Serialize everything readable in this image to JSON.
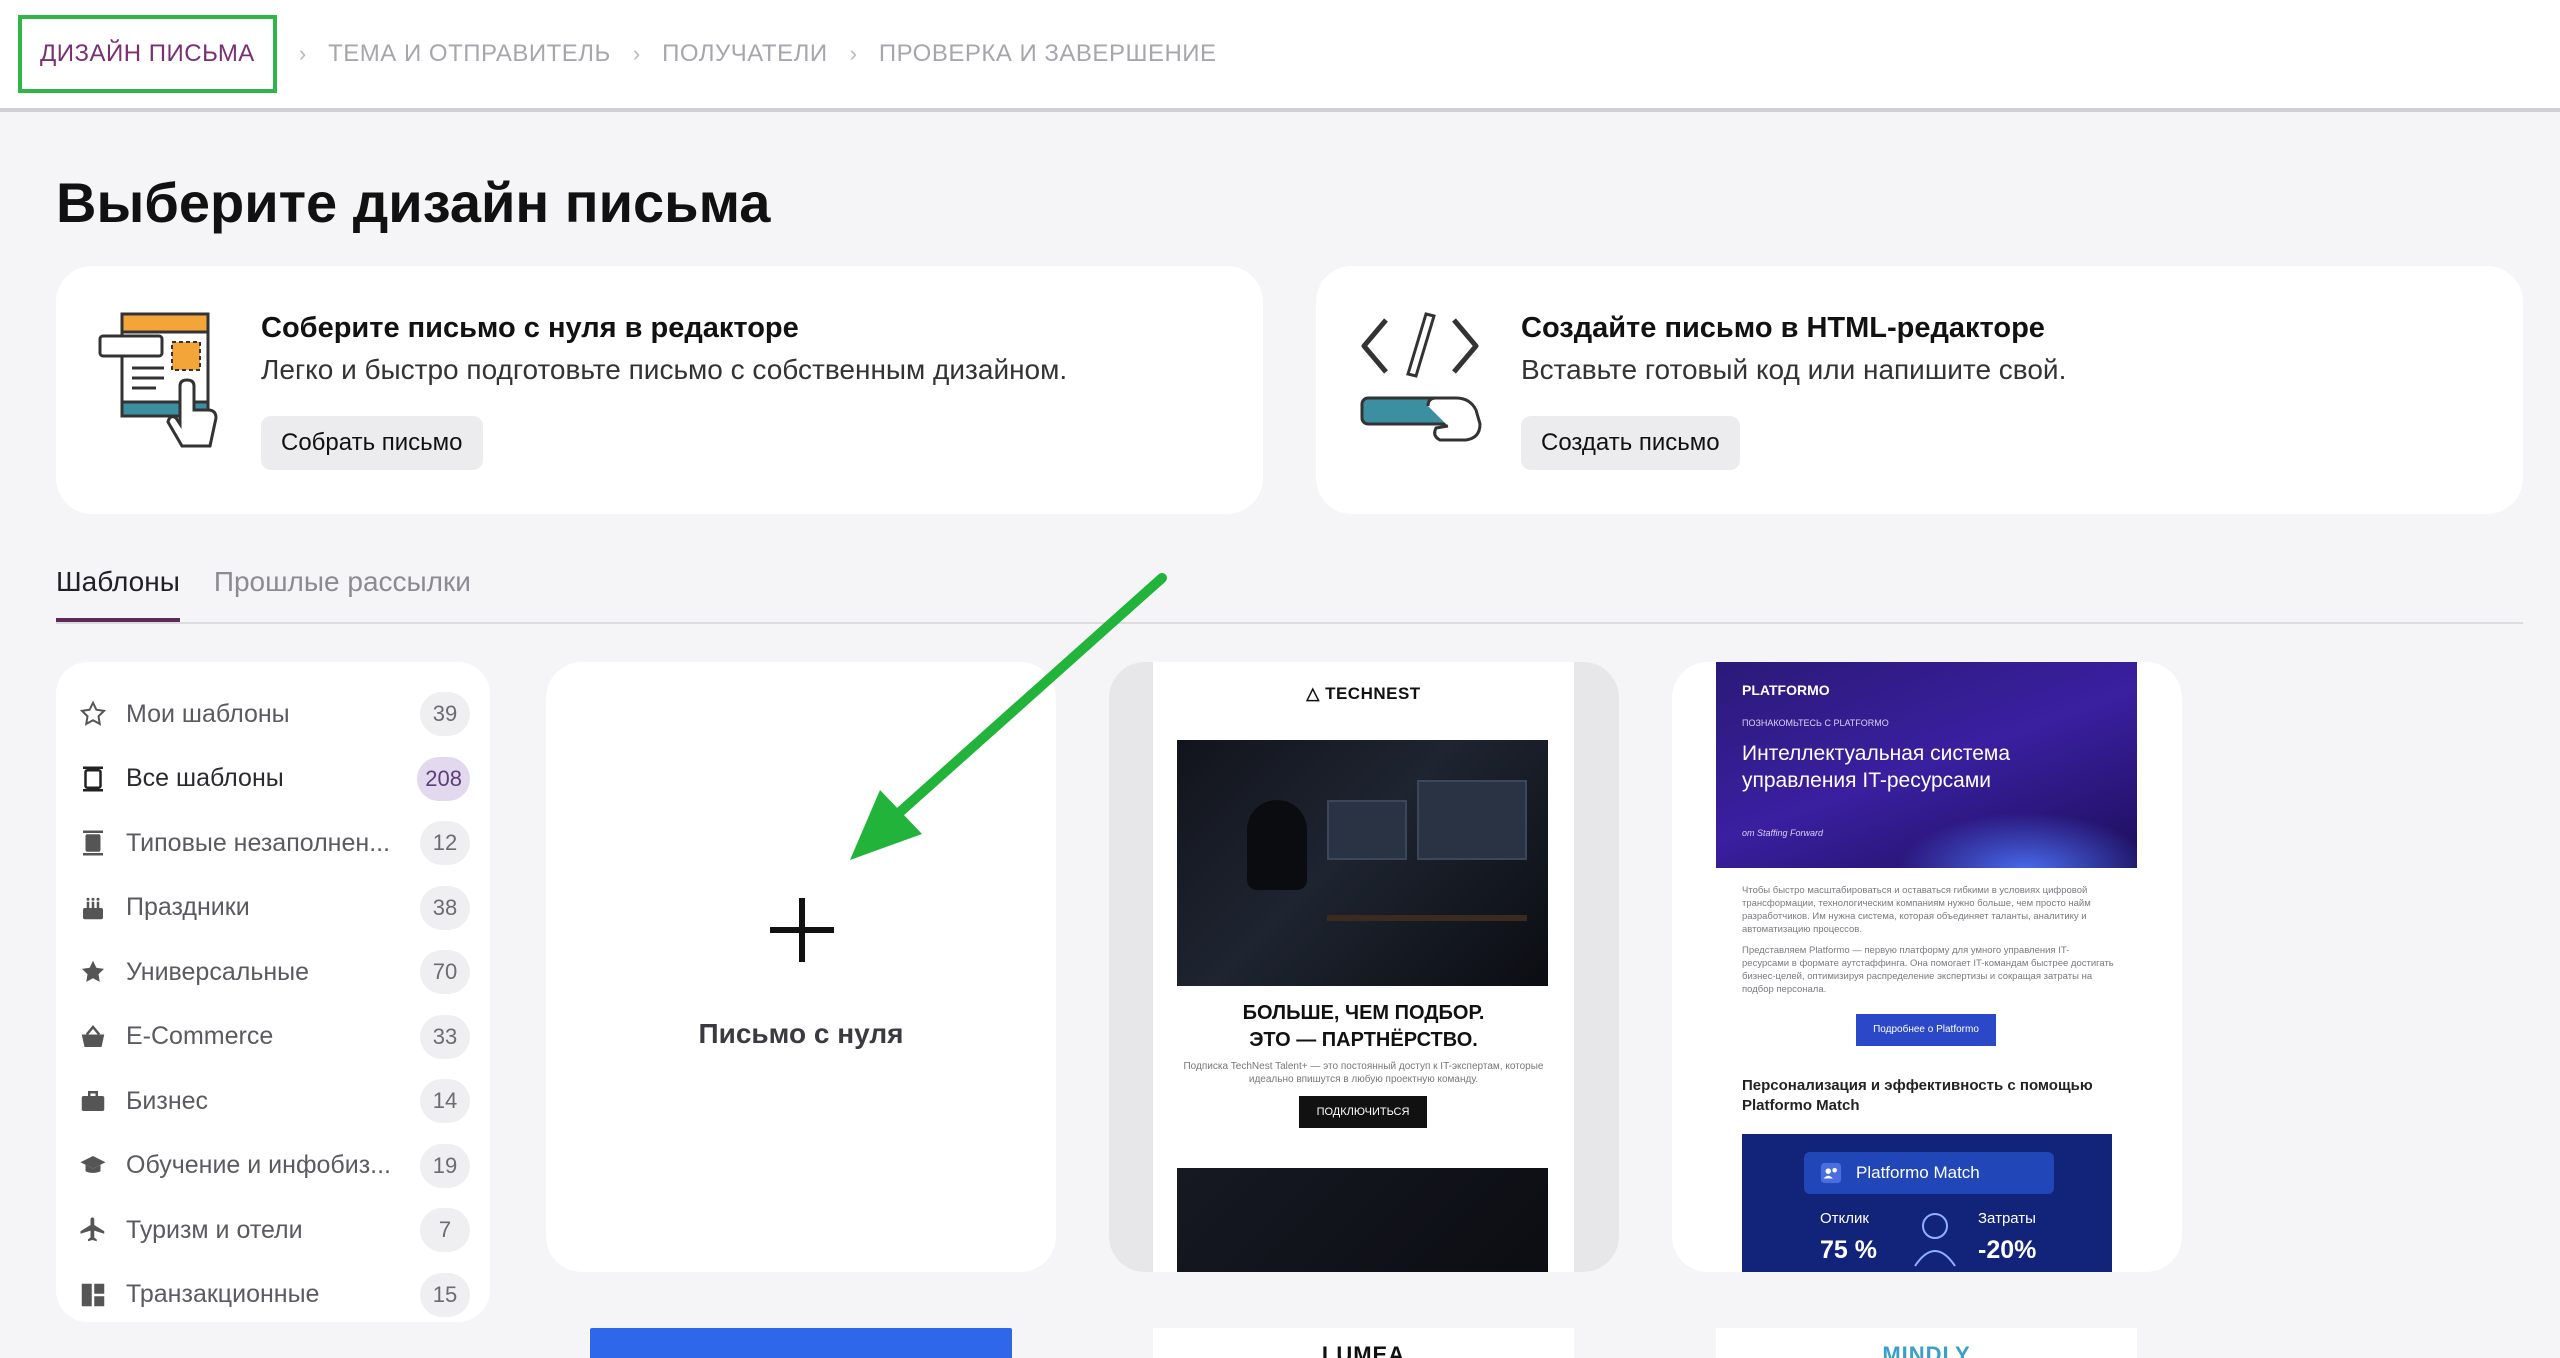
{
  "stepper": {
    "steps": [
      "ДИЗАЙН ПИСЬМА",
      "ТЕМА И ОТПРАВИТЕЛЬ",
      "ПОЛУЧАТЕЛИ",
      "ПРОВЕРКА И ЗАВЕРШЕНИЕ"
    ],
    "separator": "›"
  },
  "page_title": "Выберите дизайн письма",
  "features": {
    "builder": {
      "title": "Соберите письмо с нуля в редакторе",
      "description": "Легко и быстро подготовьте письмо с собственным дизайном.",
      "button": "Собрать письмо",
      "icon": "document-editor-icon"
    },
    "html": {
      "title": "Создайте письмо в HTML-редакторе",
      "description": "Вставьте готовый код или напишите свой.",
      "button": "Создать письмо",
      "icon": "code-tags-icon"
    }
  },
  "tabs": [
    "Шаблоны",
    "Прошлые рассылки"
  ],
  "categories": [
    {
      "label": "Мои шаблоны",
      "count": "39",
      "icon": "star-outline-icon"
    },
    {
      "label": "Все шаблоны",
      "count": "208",
      "icon": "template-stack-icon"
    },
    {
      "label": "Типовые незаполнен...",
      "count": "12",
      "icon": "template-blank-icon"
    },
    {
      "label": "Праздники",
      "count": "38",
      "icon": "cake-icon"
    },
    {
      "label": "Универсальные",
      "count": "70",
      "icon": "star-filled-icon"
    },
    {
      "label": "E-Commerce",
      "count": "33",
      "icon": "basket-icon"
    },
    {
      "label": "Бизнес",
      "count": "14",
      "icon": "briefcase-icon"
    },
    {
      "label": "Обучение и инфобиз...",
      "count": "19",
      "icon": "graduation-cap-icon"
    },
    {
      "label": "Туризм и отели",
      "count": "7",
      "icon": "airplane-icon"
    },
    {
      "label": "Транзакционные",
      "count": "15",
      "icon": "layout-icon"
    }
  ],
  "blank_template": {
    "label": "Письмо с нуля"
  },
  "technest": {
    "logo": "TECHNEST",
    "headline_1": "БОЛЬШЕ, ЧЕМ ПОДБОР.",
    "headline_2": "ЭТО — ПАРТНЁРСТВО.",
    "body": "Подписка TechNest Talent+ — это постоянный доступ к IT-экспертам, которые идеально впишутся в любую проектную команду.",
    "button": "ПОДКЛЮЧИТЬСЯ"
  },
  "platformo": {
    "logo": "PLATFORMO",
    "kicker": "ПОЗНАКОМЬТЕСЬ С PLATFORMO",
    "title": "Интеллектуальная система управления IT-ресурсами",
    "by": "от Staffing Forward",
    "text_1": "Чтобы быстро масштабироваться и оставаться гибкими в условиях цифровой трансформации, технологическим компаниям нужно больше, чем просто найм разработчиков. Им нужна система, которая объединяет таланты, аналитику и автоматизацию процессов.",
    "text_2": "Представляем Platformo — первую платформу для умного управления IT-ресурсами в формате аутстаффинга. Она помогает IT-командам быстрее достигать бизнес-целей, оптимизируя распределение экспертизы и сокращая затраты на подбор персонала.",
    "button": "Подробнее о Platformo",
    "subtitle": "Персонализация и эффективность с помощью Platformo Match",
    "panel_title": "Platformo Match",
    "stat_left_label": "Отклик",
    "stat_left_value": "75 %",
    "stat_right_label": "Затраты",
    "stat_right_value": "-20%"
  },
  "bottom_row": {
    "lumea": "LUMEA",
    "mindly": "MINDLY"
  },
  "colors": {
    "accent": "#7a2f73",
    "highlight_border": "#2fb548",
    "annotation_arrow": "#22b33a"
  }
}
